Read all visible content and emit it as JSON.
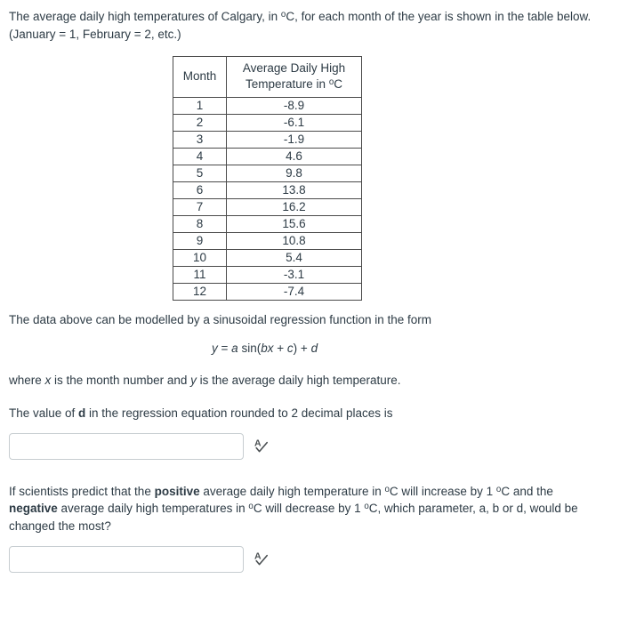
{
  "question": {
    "intro_line1": "The average daily high temperatures of Calgary, in °C, for each month of the year is",
    "intro_line2": "shown in the table below.  (January = 1, February = 2, etc.)",
    "intro_part1": "The average daily high temperatures of Calgary, in ",
    "intro_part2": "C, for each month of the year is shown in the table below.  (January = 1, February = 2, etc.)",
    "model_text": "The data above can be modelled by a sinusoidal regression function in the form",
    "equation": {
      "y": "y",
      "eq_sign": "=",
      "a": "a",
      "sin": "sin(",
      "bx": "bx",
      "plus1": "+",
      "c": "c",
      "close": ")",
      "plus2": "+",
      "d": "d",
      "full": "y = a sin(bx + c) + d"
    },
    "where_part1": "where ",
    "where_x": "x",
    "where_part2": " is the month number and ",
    "where_y": "y",
    "where_part3": " is the average daily high temperature.",
    "prompt1_part1": "The value of ",
    "prompt1_bold": "d",
    "prompt1_part2": " in the regression equation rounded to 2 decimal places is",
    "prompt2_part1": "If scientists predict that the ",
    "prompt2_bold1": "positive",
    "prompt2_part2": " average daily high temperature in ",
    "prompt2_part3": "C will increase by 1 ",
    "prompt2_part4": "C and the ",
    "prompt2_bold2": "negative",
    "prompt2_part5": " average daily high temperatures in ",
    "prompt2_part6": "C will decrease by 1 ",
    "prompt2_part7": "C, which parameter, a, b or d, would be changed the most?"
  },
  "table": {
    "headers": {
      "month": "Month",
      "temperature_line1": "Average Daily High",
      "temperature_line2_prefix": "Temperature in ",
      "temperature_line2_unit": "C",
      "temperature_full": "Average Daily High Temperature in °C"
    },
    "rows": [
      {
        "month": "1",
        "temp": "-8.9"
      },
      {
        "month": "2",
        "temp": "-6.1"
      },
      {
        "month": "3",
        "temp": "-1.9"
      },
      {
        "month": "4",
        "temp": "4.6"
      },
      {
        "month": "5",
        "temp": "9.8"
      },
      {
        "month": "6",
        "temp": "13.8"
      },
      {
        "month": "7",
        "temp": "16.2"
      },
      {
        "month": "8",
        "temp": "15.6"
      },
      {
        "month": "9",
        "temp": "10.8"
      },
      {
        "month": "10",
        "temp": "5.4"
      },
      {
        "month": "11",
        "temp": "-3.1"
      },
      {
        "month": "12",
        "temp": "-7.4"
      }
    ]
  },
  "answers": {
    "answer1": {
      "value": "",
      "placeholder": ""
    },
    "answer2": {
      "value": "",
      "placeholder": ""
    }
  },
  "icons": {
    "spellcheck": "spellcheck-icon",
    "spellcheck_letter": "A"
  },
  "colors": {
    "text": "#2d3b45",
    "table_border": "#4a4a4a",
    "input_border": "#c7cdd1",
    "icon": "#4a4f52",
    "background": "#ffffff"
  },
  "chart_data": {
    "type": "table",
    "title": "Average Daily High Temperature in °C (Calgary)",
    "xlabel": "Month",
    "ylabel": "Average Daily High Temperature in °C",
    "categories": [
      "1",
      "2",
      "3",
      "4",
      "5",
      "6",
      "7",
      "8",
      "9",
      "10",
      "11",
      "12"
    ],
    "values": [
      -8.9,
      -6.1,
      -1.9,
      4.6,
      9.8,
      13.8,
      16.2,
      15.6,
      10.8,
      5.4,
      -3.1,
      -7.4
    ]
  }
}
